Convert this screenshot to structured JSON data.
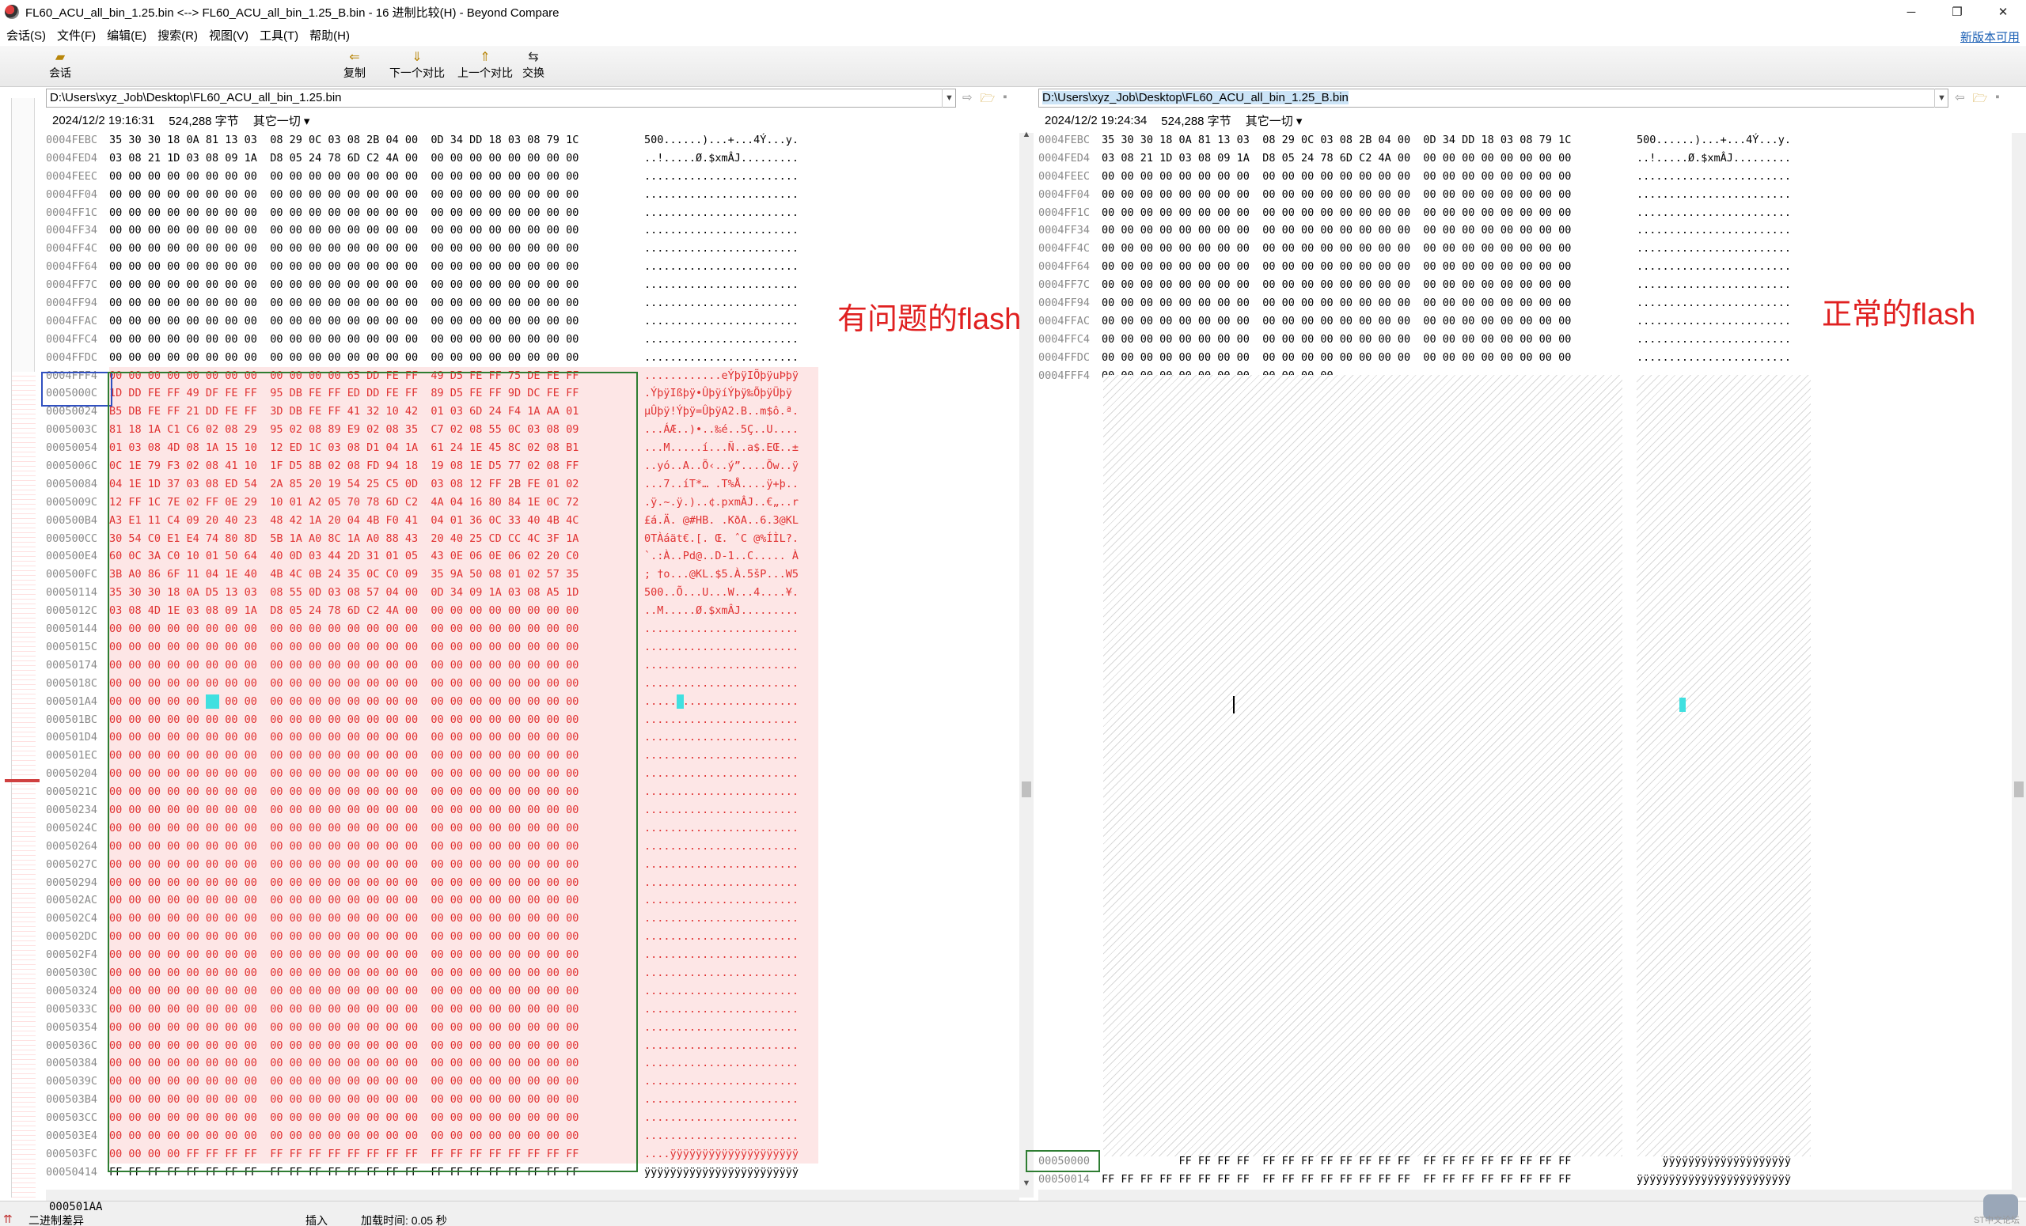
{
  "window": {
    "title": "FL60_ACU_all_bin_1.25.bin <--> FL60_ACU_all_bin_1.25_B.bin - 16 进制比较(H) - Beyond Compare",
    "minimize": "─",
    "maximize": "❐",
    "close": "✕"
  },
  "menu": {
    "items": [
      "会话(S)",
      "文件(F)",
      "编辑(E)",
      "搜索(R)",
      "视图(V)",
      "工具(T)",
      "帮助(H)"
    ],
    "new_version": "新版本可用"
  },
  "toolbar": {
    "session": "会话",
    "copy": "复制",
    "next_diff": "下一个对比",
    "prev_diff": "上一个对比",
    "swap": "交换"
  },
  "left": {
    "path": "D:\\Users\\xyz_Job\\Desktop\\FL60_ACU_all_bin_1.25.bin",
    "date": "2024/12/2 19:16:31",
    "size": "524,288 字节",
    "other": "其它一切 ▾",
    "annotation": "有问题的flash",
    "rows": [
      {
        "addr": "0004FEBC",
        "hex": "35 30 30 18 0A 81 13 03  08 29 0C 03 08 2B 04 00  0D 34 DD 18 03 08 79 1C",
        "asc": "500......)...+...4Ý...y.",
        "diff": false
      },
      {
        "addr": "0004FED4",
        "hex": "03 08 21 1D 03 08 09 1A  D8 05 24 78 6D C2 4A 00  00 00 00 00 00 00 00 00",
        "asc": "..!.....Ø.$xmÂJ.........",
        "diff": false
      },
      {
        "addr": "0004FEEC",
        "hex": "00 00 00 00 00 00 00 00  00 00 00 00 00 00 00 00  00 00 00 00 00 00 00 00",
        "asc": "........................",
        "diff": false
      },
      {
        "addr": "0004FF04",
        "hex": "00 00 00 00 00 00 00 00  00 00 00 00 00 00 00 00  00 00 00 00 00 00 00 00",
        "asc": "........................",
        "diff": false
      },
      {
        "addr": "0004FF1C",
        "hex": "00 00 00 00 00 00 00 00  00 00 00 00 00 00 00 00  00 00 00 00 00 00 00 00",
        "asc": "........................",
        "diff": false
      },
      {
        "addr": "0004FF34",
        "hex": "00 00 00 00 00 00 00 00  00 00 00 00 00 00 00 00  00 00 00 00 00 00 00 00",
        "asc": "........................",
        "diff": false
      },
      {
        "addr": "0004FF4C",
        "hex": "00 00 00 00 00 00 00 00  00 00 00 00 00 00 00 00  00 00 00 00 00 00 00 00",
        "asc": "........................",
        "diff": false
      },
      {
        "addr": "0004FF64",
        "hex": "00 00 00 00 00 00 00 00  00 00 00 00 00 00 00 00  00 00 00 00 00 00 00 00",
        "asc": "........................",
        "diff": false
      },
      {
        "addr": "0004FF7C",
        "hex": "00 00 00 00 00 00 00 00  00 00 00 00 00 00 00 00  00 00 00 00 00 00 00 00",
        "asc": "........................",
        "diff": false
      },
      {
        "addr": "0004FF94",
        "hex": "00 00 00 00 00 00 00 00  00 00 00 00 00 00 00 00  00 00 00 00 00 00 00 00",
        "asc": "........................",
        "diff": false
      },
      {
        "addr": "0004FFAC",
        "hex": "00 00 00 00 00 00 00 00  00 00 00 00 00 00 00 00  00 00 00 00 00 00 00 00",
        "asc": "........................",
        "diff": false
      },
      {
        "addr": "0004FFC4",
        "hex": "00 00 00 00 00 00 00 00  00 00 00 00 00 00 00 00  00 00 00 00 00 00 00 00",
        "asc": "........................",
        "diff": false
      },
      {
        "addr": "0004FFDC",
        "hex": "00 00 00 00 00 00 00 00  00 00 00 00 00 00 00 00  00 00 00 00 00 00 00 00",
        "asc": "........................",
        "diff": false
      },
      {
        "addr": "0004FFF4",
        "hex": "00 00 00 00 00 00 00 00  00 00 00 00 65 DD FE FF  49 D5 FE FF 75 DE FE FF",
        "asc": "............eÝþÿIÕþÿuÞþÿ",
        "diff": true
      },
      {
        "addr": "0005000C",
        "hex": "1D DD FE FF 49 DF FE FF  95 DB FE FF ED DD FE FF  89 D5 FE FF 9D DC FE FF",
        "asc": ".ÝþÿIßþÿ•ÛþÿíÝþÿ‰ÕþÿÜþÿ",
        "diff": true
      },
      {
        "addr": "00050024",
        "hex": "B5 DB FE FF 21 DD FE FF  3D DB FE FF 41 32 10 42  01 03 6D 24 F4 1A AA 01",
        "asc": "µÛþÿ!Ýþÿ=ÛþÿA2.B..m$ô.ª.",
        "diff": true
      },
      {
        "addr": "0005003C",
        "hex": "81 18 1A C1 C6 02 08 29  95 02 08 89 E9 02 08 35  C7 02 08 55 0C 03 08 09",
        "asc": "...ÁÆ..)•..‰é..5Ç..U....",
        "diff": true
      },
      {
        "addr": "00050054",
        "hex": "01 03 08 4D 08 1A 15 10  12 ED 1C 03 08 D1 04 1A  61 24 1E 45 8C 02 08 B1",
        "asc": "...M.....í...Ñ..a$.EŒ..±",
        "diff": true
      },
      {
        "addr": "0005006C",
        "hex": "0C 1E 79 F3 02 08 41 10  1F D5 8B 02 08 FD 94 18  19 08 1E D5 77 02 08 FF",
        "asc": "..yó..A..Õ‹..ý”....Õw..ÿ",
        "diff": true
      },
      {
        "addr": "00050084",
        "hex": "04 1E 1D 37 03 08 ED 54  2A 85 20 19 54 25 C5 0D  03 08 12 FF 2B FE 01 02",
        "asc": "...7..íT*… .T%Å....ÿ+þ..",
        "diff": true
      },
      {
        "addr": "0005009C",
        "hex": "12 FF 1C 7E 02 FF 0E 29  10 01 A2 05 70 78 6D C2  4A 04 16 80 84 1E 0C 72",
        "asc": ".ÿ.~.ÿ.)..¢.pxmÂJ..€„..r",
        "diff": true
      },
      {
        "addr": "000500B4",
        "hex": "A3 E1 11 C4 09 20 40 23  48 42 1A 20 04 4B F0 41  04 01 36 0C 33 40 4B 4C",
        "asc": "£á.Ä. @#HB. .KðA..6.3@KL",
        "diff": true
      },
      {
        "addr": "000500CC",
        "hex": "30 54 C0 E1 E4 74 80 8D  5B 1A A0 8C 1A A0 88 43  20 40 25 CD CC 4C 3F 1A",
        "asc": "0TÀáät€.[. Œ. ˆC @%ÍÌL?.",
        "diff": true
      },
      {
        "addr": "000500E4",
        "hex": "60 0C 3A C0 10 01 50 64  40 0D 03 44 2D 31 01 05  43 0E 06 0E 06 02 20 C0",
        "asc": "`.:À..Pd@..D-1..C..... À",
        "diff": true
      },
      {
        "addr": "000500FC",
        "hex": "3B A0 86 6F 11 04 1E 40  4B 4C 0B 24 35 0C C0 09  35 9A 50 08 01 02 57 35",
        "asc": "; †o...@KL.$5.À.5šP...W5",
        "diff": true
      },
      {
        "addr": "00050114",
        "hex": "35 30 30 18 0A D5 13 03  08 55 0D 03 08 57 04 00  0D 34 09 1A 03 08 A5 1D",
        "asc": "500..Õ...U...W...4....¥.",
        "diff": true
      },
      {
        "addr": "0005012C",
        "hex": "03 08 4D 1E 03 08 09 1A  D8 05 24 78 6D C2 4A 00  00 00 00 00 00 00 00 00",
        "asc": "..M.....Ø.$xmÂJ.........",
        "diff": true
      },
      {
        "addr": "00050144",
        "hex": "00 00 00 00 00 00 00 00  00 00 00 00 00 00 00 00  00 00 00 00 00 00 00 00",
        "asc": "........................",
        "diff": true
      },
      {
        "addr": "0005015C",
        "hex": "00 00 00 00 00 00 00 00  00 00 00 00 00 00 00 00  00 00 00 00 00 00 00 00",
        "asc": "........................",
        "diff": true
      },
      {
        "addr": "00050174",
        "hex": "00 00 00 00 00 00 00 00  00 00 00 00 00 00 00 00  00 00 00 00 00 00 00 00",
        "asc": "........................",
        "diff": true
      },
      {
        "addr": "0005018C",
        "hex": "00 00 00 00 00 00 00 00  00 00 00 00 00 00 00 00  00 00 00 00 00 00 00 00",
        "asc": "........................",
        "diff": true
      },
      {
        "addr": "000501A4",
        "hex": "00 00 00 00 00 00 00 00  00 00 00 00 00 00 00 00  00 00 00 00 00 00 00 00",
        "asc": "........................",
        "diff": true
      },
      {
        "addr": "000501BC",
        "hex": "00 00 00 00 00 00 00 00  00 00 00 00 00 00 00 00  00 00 00 00 00 00 00 00",
        "asc": "........................",
        "diff": true
      },
      {
        "addr": "000501D4",
        "hex": "00 00 00 00 00 00 00 00  00 00 00 00 00 00 00 00  00 00 00 00 00 00 00 00",
        "asc": "........................",
        "diff": true
      },
      {
        "addr": "000501EC",
        "hex": "00 00 00 00 00 00 00 00  00 00 00 00 00 00 00 00  00 00 00 00 00 00 00 00",
        "asc": "........................",
        "diff": true
      },
      {
        "addr": "00050204",
        "hex": "00 00 00 00 00 00 00 00  00 00 00 00 00 00 00 00  00 00 00 00 00 00 00 00",
        "asc": "........................",
        "diff": true
      },
      {
        "addr": "0005021C",
        "hex": "00 00 00 00 00 00 00 00  00 00 00 00 00 00 00 00  00 00 00 00 00 00 00 00",
        "asc": "........................",
        "diff": true
      },
      {
        "addr": "00050234",
        "hex": "00 00 00 00 00 00 00 00  00 00 00 00 00 00 00 00  00 00 00 00 00 00 00 00",
        "asc": "........................",
        "diff": true
      },
      {
        "addr": "0005024C",
        "hex": "00 00 00 00 00 00 00 00  00 00 00 00 00 00 00 00  00 00 00 00 00 00 00 00",
        "asc": "........................",
        "diff": true
      },
      {
        "addr": "00050264",
        "hex": "00 00 00 00 00 00 00 00  00 00 00 00 00 00 00 00  00 00 00 00 00 00 00 00",
        "asc": "........................",
        "diff": true
      },
      {
        "addr": "0005027C",
        "hex": "00 00 00 00 00 00 00 00  00 00 00 00 00 00 00 00  00 00 00 00 00 00 00 00",
        "asc": "........................",
        "diff": true
      },
      {
        "addr": "00050294",
        "hex": "00 00 00 00 00 00 00 00  00 00 00 00 00 00 00 00  00 00 00 00 00 00 00 00",
        "asc": "........................",
        "diff": true
      },
      {
        "addr": "000502AC",
        "hex": "00 00 00 00 00 00 00 00  00 00 00 00 00 00 00 00  00 00 00 00 00 00 00 00",
        "asc": "........................",
        "diff": true
      },
      {
        "addr": "000502C4",
        "hex": "00 00 00 00 00 00 00 00  00 00 00 00 00 00 00 00  00 00 00 00 00 00 00 00",
        "asc": "........................",
        "diff": true
      },
      {
        "addr": "000502DC",
        "hex": "00 00 00 00 00 00 00 00  00 00 00 00 00 00 00 00  00 00 00 00 00 00 00 00",
        "asc": "........................",
        "diff": true
      },
      {
        "addr": "000502F4",
        "hex": "00 00 00 00 00 00 00 00  00 00 00 00 00 00 00 00  00 00 00 00 00 00 00 00",
        "asc": "........................",
        "diff": true
      },
      {
        "addr": "0005030C",
        "hex": "00 00 00 00 00 00 00 00  00 00 00 00 00 00 00 00  00 00 00 00 00 00 00 00",
        "asc": "........................",
        "diff": true
      },
      {
        "addr": "00050324",
        "hex": "00 00 00 00 00 00 00 00  00 00 00 00 00 00 00 00  00 00 00 00 00 00 00 00",
        "asc": "........................",
        "diff": true
      },
      {
        "addr": "0005033C",
        "hex": "00 00 00 00 00 00 00 00  00 00 00 00 00 00 00 00  00 00 00 00 00 00 00 00",
        "asc": "........................",
        "diff": true
      },
      {
        "addr": "00050354",
        "hex": "00 00 00 00 00 00 00 00  00 00 00 00 00 00 00 00  00 00 00 00 00 00 00 00",
        "asc": "........................",
        "diff": true
      },
      {
        "addr": "0005036C",
        "hex": "00 00 00 00 00 00 00 00  00 00 00 00 00 00 00 00  00 00 00 00 00 00 00 00",
        "asc": "........................",
        "diff": true
      },
      {
        "addr": "00050384",
        "hex": "00 00 00 00 00 00 00 00  00 00 00 00 00 00 00 00  00 00 00 00 00 00 00 00",
        "asc": "........................",
        "diff": true
      },
      {
        "addr": "0005039C",
        "hex": "00 00 00 00 00 00 00 00  00 00 00 00 00 00 00 00  00 00 00 00 00 00 00 00",
        "asc": "........................",
        "diff": true
      },
      {
        "addr": "000503B4",
        "hex": "00 00 00 00 00 00 00 00  00 00 00 00 00 00 00 00  00 00 00 00 00 00 00 00",
        "asc": "........................",
        "diff": true
      },
      {
        "addr": "000503CC",
        "hex": "00 00 00 00 00 00 00 00  00 00 00 00 00 00 00 00  00 00 00 00 00 00 00 00",
        "asc": "........................",
        "diff": true
      },
      {
        "addr": "000503E4",
        "hex": "00 00 00 00 00 00 00 00  00 00 00 00 00 00 00 00  00 00 00 00 00 00 00 00",
        "asc": "........................",
        "diff": true
      },
      {
        "addr": "000503FC",
        "hex": "00 00 00 00 FF FF FF FF  FF FF FF FF FF FF FF FF  FF FF FF FF FF FF FF FF",
        "asc": "....ÿÿÿÿÿÿÿÿÿÿÿÿÿÿÿÿÿÿÿÿ",
        "diff": true
      },
      {
        "addr": "00050414",
        "hex": "FF FF FF FF FF FF FF FF  FF FF FF FF FF FF FF FF  FF FF FF FF FF FF FF FF",
        "asc": "ÿÿÿÿÿÿÿÿÿÿÿÿÿÿÿÿÿÿÿÿÿÿÿÿ",
        "diff": false
      }
    ]
  },
  "right": {
    "path": "D:\\Users\\xyz_Job\\Desktop\\FL60_ACU_all_bin_1.25_B.bin",
    "date": "2024/12/2 19:24:34",
    "size": "524,288 字节",
    "other": "其它一切 ▾",
    "annotation": "正常的flash",
    "rows": [
      {
        "addr": "0004FEBC",
        "hex": "35 30 30 18 0A 81 13 03  08 29 0C 03 08 2B 04 00  0D 34 DD 18 03 08 79 1C",
        "asc": "500......)...+...4Ý...y."
      },
      {
        "addr": "0004FED4",
        "hex": "03 08 21 1D 03 08 09 1A  D8 05 24 78 6D C2 4A 00  00 00 00 00 00 00 00 00",
        "asc": "..!.....Ø.$xmÂJ........."
      },
      {
        "addr": "0004FEEC",
        "hex": "00 00 00 00 00 00 00 00  00 00 00 00 00 00 00 00  00 00 00 00 00 00 00 00",
        "asc": "........................"
      },
      {
        "addr": "0004FF04",
        "hex": "00 00 00 00 00 00 00 00  00 00 00 00 00 00 00 00  00 00 00 00 00 00 00 00",
        "asc": "........................"
      },
      {
        "addr": "0004FF1C",
        "hex": "00 00 00 00 00 00 00 00  00 00 00 00 00 00 00 00  00 00 00 00 00 00 00 00",
        "asc": "........................"
      },
      {
        "addr": "0004FF34",
        "hex": "00 00 00 00 00 00 00 00  00 00 00 00 00 00 00 00  00 00 00 00 00 00 00 00",
        "asc": "........................"
      },
      {
        "addr": "0004FF4C",
        "hex": "00 00 00 00 00 00 00 00  00 00 00 00 00 00 00 00  00 00 00 00 00 00 00 00",
        "asc": "........................"
      },
      {
        "addr": "0004FF64",
        "hex": "00 00 00 00 00 00 00 00  00 00 00 00 00 00 00 00  00 00 00 00 00 00 00 00",
        "asc": "........................"
      },
      {
        "addr": "0004FF7C",
        "hex": "00 00 00 00 00 00 00 00  00 00 00 00 00 00 00 00  00 00 00 00 00 00 00 00",
        "asc": "........................"
      },
      {
        "addr": "0004FF94",
        "hex": "00 00 00 00 00 00 00 00  00 00 00 00 00 00 00 00  00 00 00 00 00 00 00 00",
        "asc": "........................"
      },
      {
        "addr": "0004FFAC",
        "hex": "00 00 00 00 00 00 00 00  00 00 00 00 00 00 00 00  00 00 00 00 00 00 00 00",
        "asc": "........................"
      },
      {
        "addr": "0004FFC4",
        "hex": "00 00 00 00 00 00 00 00  00 00 00 00 00 00 00 00  00 00 00 00 00 00 00 00",
        "asc": "........................"
      },
      {
        "addr": "0004FFDC",
        "hex": "00 00 00 00 00 00 00 00  00 00 00 00 00 00 00 00  00 00 00 00 00 00 00 00",
        "asc": "........................"
      },
      {
        "addr": "0004FFF4",
        "hex": "00 00 00 00 00 00 00 00  00 00 00 00",
        "asc": "............"
      }
    ],
    "bottom_rows": [
      {
        "addr": "00050000",
        "hex": "            FF FF FF FF  FF FF FF FF FF FF FF FF  FF FF FF FF FF FF FF FF",
        "asc": "    ÿÿÿÿÿÿÿÿÿÿÿÿÿÿÿÿÿÿÿÿ"
      },
      {
        "addr": "00050014",
        "hex": "FF FF FF FF FF FF FF FF  FF FF FF FF FF FF FF FF  FF FF FF FF FF FF FF FF",
        "asc": "ÿÿÿÿÿÿÿÿÿÿÿÿÿÿÿÿÿÿÿÿÿÿÿÿ"
      }
    ]
  },
  "status": {
    "offset": "000501AA",
    "mode": "二进制差异",
    "insert": "插入",
    "load_time": "加载时间: 0.05 秒",
    "watermark": "ST中文论坛"
  }
}
